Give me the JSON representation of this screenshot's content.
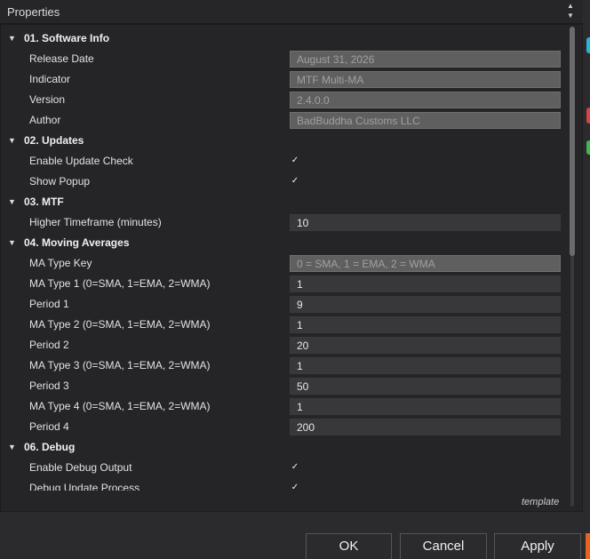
{
  "window": {
    "title": "Properties"
  },
  "categories": [
    {
      "label": "01. Software Info",
      "properties": [
        {
          "label": "Release Date",
          "value": "August 31, 2026",
          "readonly": true
        },
        {
          "label": "Indicator",
          "value": "MTF Multi-MA",
          "readonly": true
        },
        {
          "label": "Version",
          "value": "2.4.0.0",
          "readonly": true
        },
        {
          "label": "Author",
          "value": "BadBuddha Customs LLC",
          "readonly": true
        }
      ]
    },
    {
      "label": "02. Updates",
      "properties": [
        {
          "label": "Enable Update Check",
          "checked": true
        },
        {
          "label": "Show Popup",
          "checked": true
        }
      ]
    },
    {
      "label": "03. MTF",
      "properties": [
        {
          "label": "Higher Timeframe (minutes)",
          "value": "10"
        }
      ]
    },
    {
      "label": "04. Moving Averages",
      "properties": [
        {
          "label": "MA Type Key",
          "value": "0 = SMA, 1 = EMA, 2 = WMA",
          "readonly": true
        },
        {
          "label": "MA Type 1 (0=SMA, 1=EMA, 2=WMA)",
          "value": "1"
        },
        {
          "label": "Period 1",
          "value": "9"
        },
        {
          "label": "MA Type 2 (0=SMA, 1=EMA, 2=WMA)",
          "value": "1"
        },
        {
          "label": "Period 2",
          "value": "20"
        },
        {
          "label": "MA Type 3 (0=SMA, 1=EMA, 2=WMA)",
          "value": "1"
        },
        {
          "label": "Period 3",
          "value": "50"
        },
        {
          "label": "MA Type 4 (0=SMA, 1=EMA, 2=WMA)",
          "value": "1"
        },
        {
          "label": "Period 4",
          "value": "200"
        }
      ]
    },
    {
      "label": "06. Debug",
      "properties": [
        {
          "label": "Enable Debug Output",
          "checked": true
        },
        {
          "label": "Debug Update Process",
          "checked": true
        }
      ]
    }
  ],
  "template_label": "template",
  "buttons": {
    "ok": "OK",
    "cancel": "Cancel",
    "apply": "Apply"
  },
  "icons": {
    "caret": "caret-down-icon",
    "check": "checkmark-icon",
    "scroll_up": "scroll-up-icon",
    "scroll_down": "scroll-down-icon"
  },
  "colors": {
    "background": "#2b2b2d",
    "panel": "#252527",
    "readonly_field": "#5f5f5f",
    "editable_field": "#38383a",
    "accent_cyan": "#29b6d6",
    "accent_red": "#d64545",
    "accent_green": "#3fb950",
    "accent_orange": "#e8631c"
  }
}
